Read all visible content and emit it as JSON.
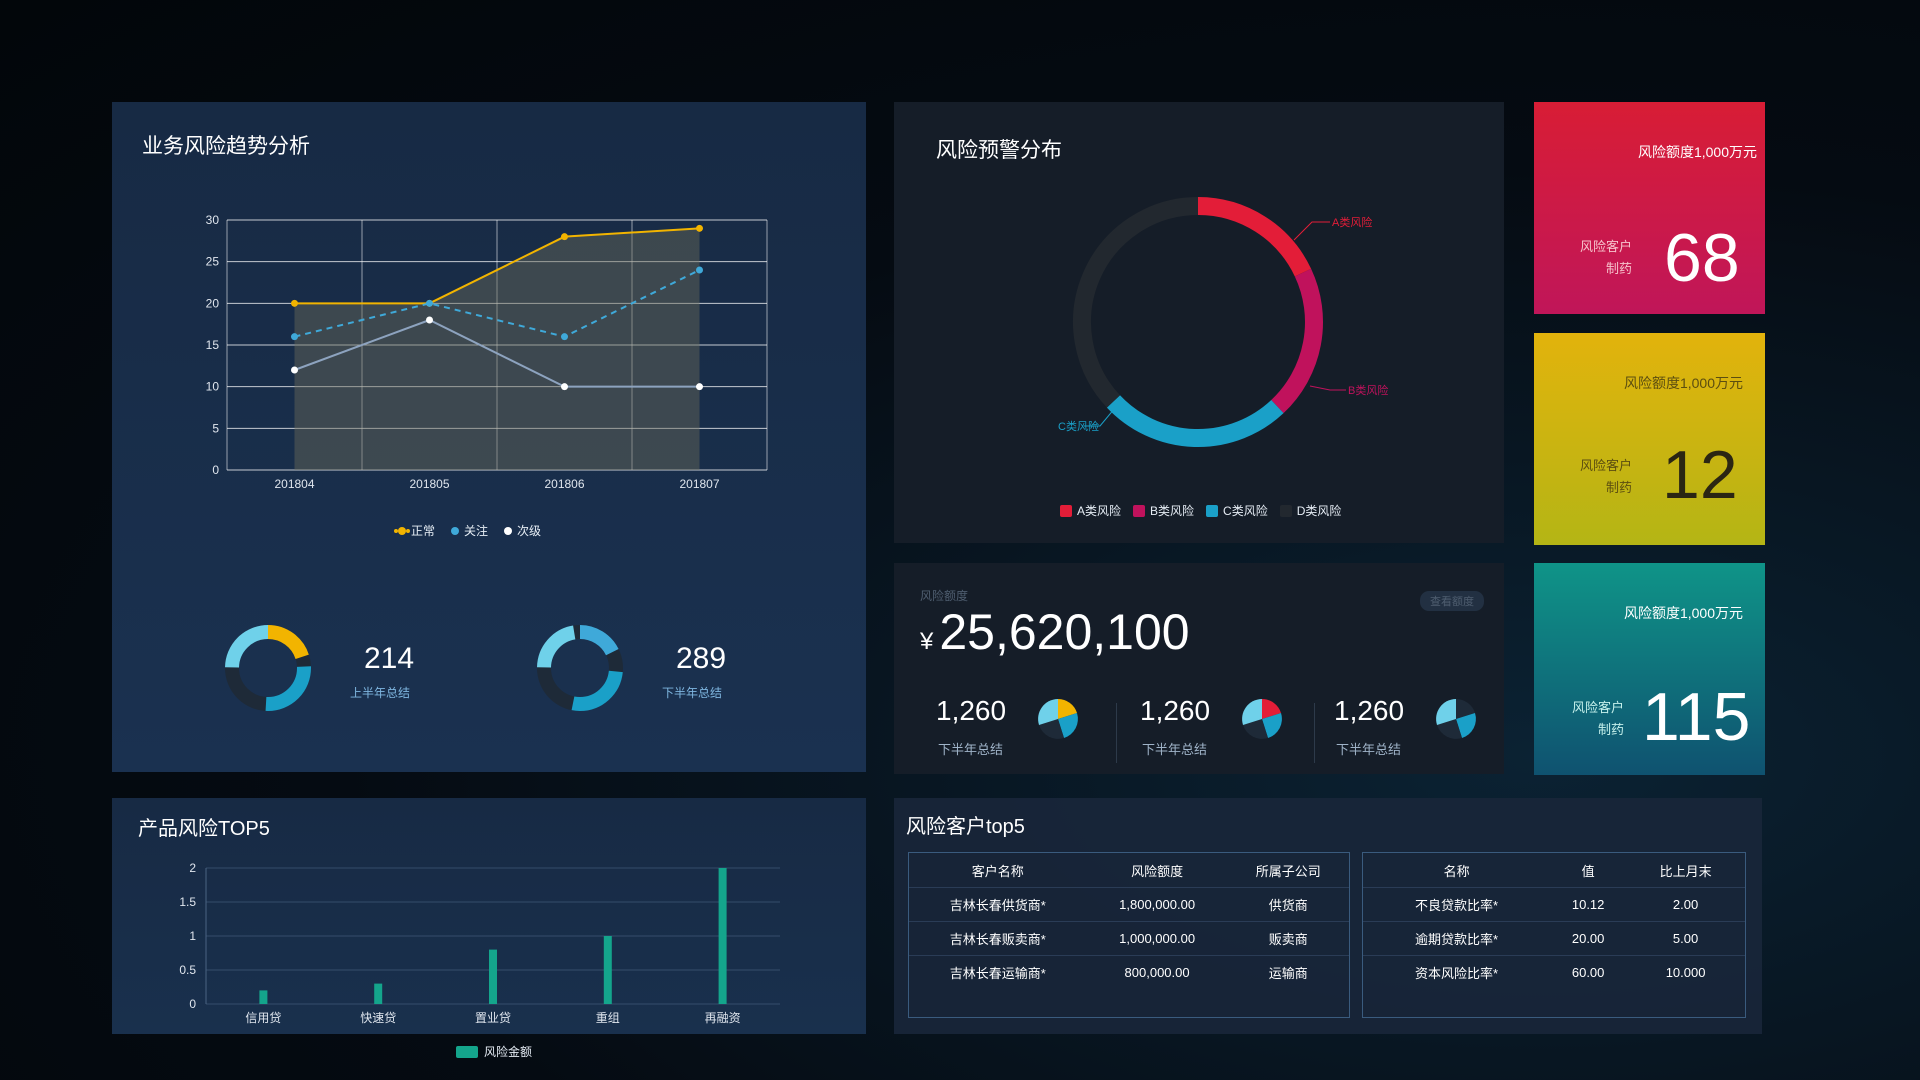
{
  "trend": {
    "title": "业务风险趋势分析",
    "legend": [
      {
        "label": "正常",
        "color": "#f2b400"
      },
      {
        "label": "关注",
        "color": "#3fa9d9"
      },
      {
        "label": "次级",
        "color": "#ffffff"
      }
    ],
    "stat1": {
      "value": "214",
      "label": "上半年总结"
    },
    "stat2": {
      "value": "289",
      "label": "下半年总结"
    }
  },
  "distribution": {
    "title": "风险预警分布",
    "legend": [
      {
        "label": "A类风险",
        "color": "#e31d38"
      },
      {
        "label": "B类风险",
        "color": "#c0125c"
      },
      {
        "label": "C类风险",
        "color": "#1aa0c8"
      },
      {
        "label": "D类风险",
        "color": "#22282f"
      }
    ],
    "callouts": {
      "a": "A类风险",
      "b": "B类风险",
      "c": "C类风险"
    }
  },
  "amount": {
    "label": "风险额度",
    "button": "查看额度",
    "currency": "¥",
    "value": "25,620,100",
    "items": [
      {
        "value": "1,260",
        "label": "下半年总结"
      },
      {
        "value": "1,260",
        "label": "下半年总结"
      },
      {
        "value": "1,260",
        "label": "下半年总结"
      }
    ]
  },
  "cards": [
    {
      "top": "风险额度1,000万元",
      "sub1": "风险客户",
      "sub2": "制药",
      "value": "68"
    },
    {
      "top": "风险额度1,000万元",
      "sub1": "风险客户",
      "sub2": "制药",
      "value": "12"
    },
    {
      "top": "风险额度1,000万元",
      "sub1": "风险客户",
      "sub2": "制药",
      "value": "115"
    }
  ],
  "product": {
    "title": "产品风险TOP5",
    "legend": "风险金额",
    "bar_color": "#14a58c"
  },
  "customers": {
    "title": "风险客户top5",
    "left_headers": [
      "客户名称",
      "风险额度",
      "所属子公司"
    ],
    "left_rows": [
      [
        "吉林长春供货商*",
        "1,800,000.00",
        "供货商"
      ],
      [
        "吉林长春贩卖商*",
        "1,000,000.00",
        "贩卖商"
      ],
      [
        "吉林长春运输商*",
        "800,000.00",
        "运输商"
      ]
    ],
    "right_headers": [
      "名称",
      "值",
      "比上月末"
    ],
    "right_rows": [
      [
        "不良贷款比率*",
        "10.12",
        "2.00"
      ],
      [
        "逾期贷款比率*",
        "20.00",
        "5.00"
      ],
      [
        "资本风险比率*",
        "60.00",
        "10.000"
      ]
    ]
  },
  "chart_data": [
    {
      "type": "line",
      "x": [
        "201804",
        "201805",
        "201806",
        "201807"
      ],
      "ylim": [
        0,
        30
      ],
      "yticks": [
        0,
        5,
        10,
        15,
        20,
        25,
        30
      ],
      "grid": true,
      "legend_position": "bottom",
      "series": [
        {
          "name": "正常",
          "values": [
            20,
            20,
            28,
            29
          ],
          "color": "#f2b400"
        },
        {
          "name": "关注",
          "values": [
            16,
            20,
            16,
            24
          ],
          "color": "#3fa9d9"
        },
        {
          "name": "次级",
          "values": [
            12,
            18,
            10,
            10
          ],
          "color": "#ffffff"
        }
      ]
    },
    {
      "type": "pie",
      "labels": [
        "A类风险",
        "B类风险",
        "C类风险",
        "D类风险"
      ],
      "values": [
        18,
        20,
        25,
        37
      ],
      "colors": [
        "#e31d38",
        "#c0125c",
        "#1aa0c8",
        "#22282f"
      ],
      "legend_position": "bottom"
    },
    {
      "type": "bar",
      "categories": [
        "信用贷",
        "快速贷",
        "置业贷",
        "重组",
        "再融资"
      ],
      "series": [
        {
          "name": "风险金额",
          "values": [
            0.2,
            0.3,
            0.8,
            1.0,
            2.0
          ]
        }
      ],
      "ylim": [
        0,
        2
      ],
      "yticks": [
        0,
        0.5,
        1,
        1.5,
        2
      ],
      "grid": true,
      "legend_position": "bottom"
    }
  ]
}
